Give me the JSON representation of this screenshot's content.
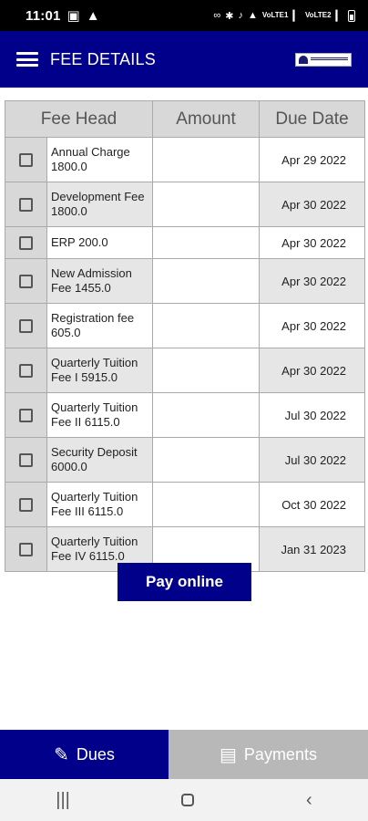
{
  "status_bar": {
    "time": "11:01",
    "left_icons": [
      "image-icon",
      "warning-icon"
    ],
    "right_icons": [
      "link-icon",
      "bluetooth-icon",
      "mute-icon",
      "wifi-icon",
      "signal-icon",
      "battery-icon"
    ],
    "volte1": "VoLTE1",
    "volte2": "VoLTE2"
  },
  "app_bar": {
    "title": "FEE DETAILS",
    "menu_icon": "hamburger-icon",
    "logo_icon": "school-logo"
  },
  "table": {
    "headers": [
      "Fee Head",
      "Amount",
      "Due Date"
    ],
    "rows": [
      {
        "fee_head": "Annual Charge 1800.0",
        "amount": "",
        "due_date": "Apr 29 2022"
      },
      {
        "fee_head": "Development Fee 1800.0",
        "amount": "",
        "due_date": "Apr 30 2022"
      },
      {
        "fee_head": "ERP 200.0",
        "amount": "",
        "due_date": "Apr 30 2022"
      },
      {
        "fee_head": "New Admission Fee 1455.0",
        "amount": "",
        "due_date": "Apr 30 2022"
      },
      {
        "fee_head": "Registration fee 605.0",
        "amount": "",
        "due_date": "Apr 30 2022"
      },
      {
        "fee_head": "Quarterly Tuition Fee I 5915.0",
        "amount": "",
        "due_date": "Apr 30 2022"
      },
      {
        "fee_head": "Quarterly Tuition Fee II 6115.0",
        "amount": "",
        "due_date": "Jul 30 2022"
      },
      {
        "fee_head": "Security Deposit 6000.0",
        "amount": "",
        "due_date": "Jul 30 2022"
      },
      {
        "fee_head": "Quarterly Tuition Fee III 6115.0",
        "amount": "",
        "due_date": "Oct 30 2022"
      },
      {
        "fee_head": "Quarterly Tuition Fee IV 6115.0",
        "amount": "",
        "due_date": "Jan 31 2023"
      }
    ]
  },
  "pay_button": {
    "label": "Pay online"
  },
  "bottom_nav": {
    "tabs": [
      {
        "label": "Dues",
        "icon": "edit-note-icon",
        "active": true
      },
      {
        "label": "Payments",
        "icon": "receipt-icon",
        "active": false
      }
    ]
  },
  "system_nav": {
    "icons": [
      "recents-icon",
      "home-icon",
      "back-icon"
    ]
  },
  "colors": {
    "primary": "#00008b",
    "header_bg": "#d8d8d8",
    "stripe": "#e6e6e6",
    "inactive_tab": "#b8b8b8"
  }
}
